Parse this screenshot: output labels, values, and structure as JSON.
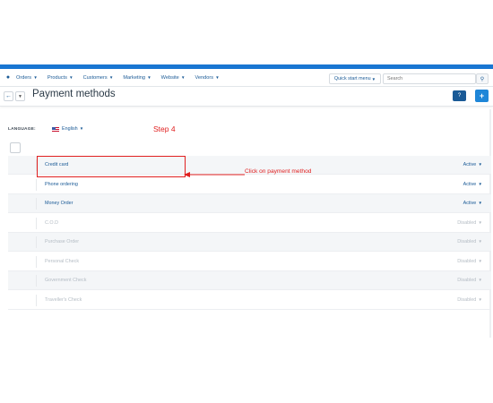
{
  "nav": {
    "items": [
      {
        "label": "Orders"
      },
      {
        "label": "Products"
      },
      {
        "label": "Customers"
      },
      {
        "label": "Marketing"
      },
      {
        "label": "Website"
      },
      {
        "label": "Vendors"
      }
    ],
    "quick_menu_label": "Quick start menu",
    "search_placeholder": "Search"
  },
  "header": {
    "title": "Payment methods",
    "help_label": "?",
    "add_label": "+"
  },
  "language": {
    "label": "LANGUAGE:",
    "selected": "English"
  },
  "annotation": {
    "step": "Step 4",
    "callout": "Click on payment method",
    "color": "#e02020"
  },
  "payment_methods": [
    {
      "name": "Credit card",
      "status": "Active"
    },
    {
      "name": "Phone ordering",
      "status": "Active"
    },
    {
      "name": "Money Order",
      "status": "Active"
    },
    {
      "name": "C.O.D",
      "status": "Disabled"
    },
    {
      "name": "Purchase Order",
      "status": "Disabled"
    },
    {
      "name": "Personal Check",
      "status": "Disabled"
    },
    {
      "name": "Government Check",
      "status": "Disabled"
    },
    {
      "name": "Traveller's Check",
      "status": "Disabled"
    }
  ],
  "colors": {
    "accent": "#1976d2",
    "link": "#1a5a96",
    "disabled": "#b4bcc4"
  }
}
